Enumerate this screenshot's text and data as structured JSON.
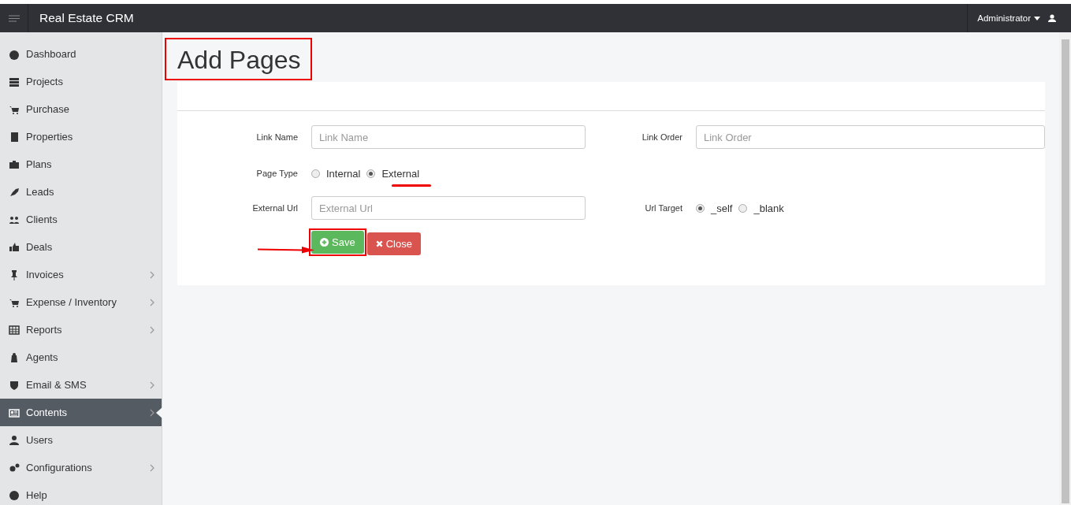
{
  "header": {
    "title": "Real Estate CRM",
    "user": "Administrator"
  },
  "sidebar": {
    "items": [
      {
        "label": "Dashboard",
        "submenu": false,
        "selected": false
      },
      {
        "label": "Projects",
        "submenu": false,
        "selected": false
      },
      {
        "label": "Purchase",
        "submenu": false,
        "selected": false
      },
      {
        "label": "Properties",
        "submenu": false,
        "selected": false
      },
      {
        "label": "Plans",
        "submenu": false,
        "selected": false
      },
      {
        "label": "Leads",
        "submenu": false,
        "selected": false
      },
      {
        "label": "Clients",
        "submenu": false,
        "selected": false
      },
      {
        "label": "Deals",
        "submenu": false,
        "selected": false
      },
      {
        "label": "Invoices",
        "submenu": true,
        "selected": false
      },
      {
        "label": "Expense / Inventory",
        "submenu": true,
        "selected": false
      },
      {
        "label": "Reports",
        "submenu": true,
        "selected": false
      },
      {
        "label": "Agents",
        "submenu": false,
        "selected": false
      },
      {
        "label": "Email & SMS",
        "submenu": true,
        "selected": false
      },
      {
        "label": "Contents",
        "submenu": true,
        "selected": true
      },
      {
        "label": "Users",
        "submenu": false,
        "selected": false
      },
      {
        "label": "Configurations",
        "submenu": true,
        "selected": false
      },
      {
        "label": "Help",
        "submenu": false,
        "selected": false
      }
    ]
  },
  "page": {
    "title": "Add Pages",
    "link_name": {
      "label": "Link Name",
      "placeholder": "Link Name"
    },
    "link_order": {
      "label": "Link Order",
      "placeholder": "Link Order"
    },
    "page_type": {
      "label": "Page Type",
      "options": [
        {
          "label": "Internal",
          "selected": false
        },
        {
          "label": "External",
          "selected": true
        }
      ]
    },
    "external_url": {
      "label": "External Url",
      "placeholder": "External Url"
    },
    "url_target": {
      "label": "Url Target",
      "options": [
        {
          "label": "_self",
          "selected": true
        },
        {
          "label": "_blank",
          "selected": false
        }
      ]
    },
    "buttons": [
      {
        "kind": "save",
        "label": "Save"
      },
      {
        "kind": "close",
        "label": "Close"
      }
    ]
  }
}
